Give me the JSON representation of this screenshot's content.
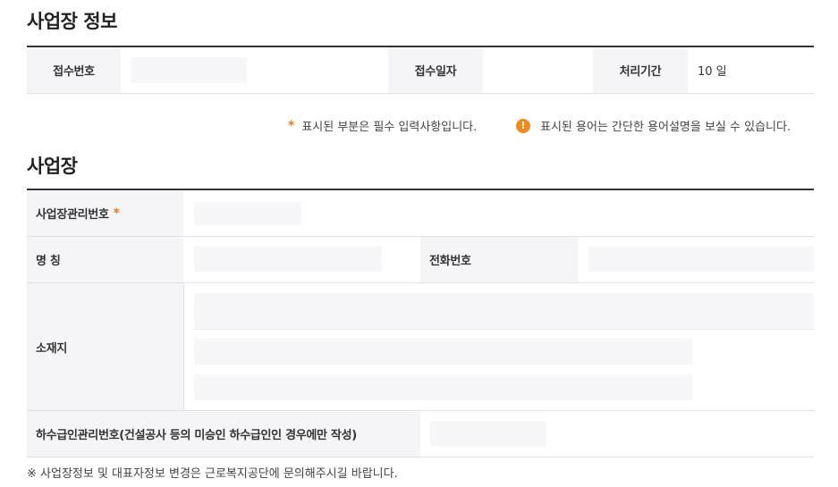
{
  "section1": {
    "title": "사업장 정보"
  },
  "info_row": {
    "receipt_no_label": "접수번호",
    "receipt_date_label": "접수일자",
    "processing_period_label": "처리기간",
    "processing_period_value": "10 일"
  },
  "notes": {
    "required_mark": "*",
    "required_text": "표시된 부분은 필수 입력사항입니다.",
    "info_icon_glyph": "!",
    "info_text": "표시된 용어는 간단한 용어설명을 보실 수 있습니다."
  },
  "section2": {
    "title": "사업장"
  },
  "form": {
    "mgmt_no_label": "사업장관리번호",
    "required_mark": "*",
    "name_label": "명 칭",
    "phone_label": "전화번호",
    "address_label": "소재지",
    "subcontract_label": "하수급인관리번호(건설공사 등의 미승인 하수급인인 경우에만 작성)"
  },
  "footnote": "※ 사업장정보 및 대표자정보 변경은 근로복지공단에 문의해주시길 바랍니다.",
  "colors": {
    "accent": "#e87a1c",
    "info_icon": "#f08a1c",
    "header_bg": "#f5f5f7"
  }
}
